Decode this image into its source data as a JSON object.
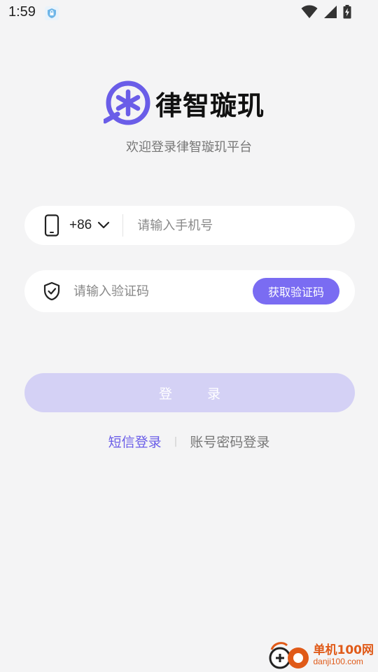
{
  "status_bar": {
    "time": "1:59",
    "icons": [
      "vpn-shield-icon",
      "wifi-icon",
      "signal-icon",
      "battery-charging-icon"
    ]
  },
  "brand": {
    "name": "律智璇玑",
    "subtitle": "欢迎登录律智璇玑平台",
    "accent_color": "#6a5de8"
  },
  "phone_field": {
    "country_code": "+86",
    "placeholder": "请输入手机号",
    "value": ""
  },
  "code_field": {
    "placeholder": "请输入验证码",
    "value": "",
    "get_code_label": "获取验证码"
  },
  "login_button": {
    "label": "登 录",
    "disabled": true
  },
  "login_modes": {
    "sms": "短信登录",
    "separator": "|",
    "password": "账号密码登录"
  },
  "watermark": {
    "line1": "单机100网",
    "line2": "danji100.com"
  }
}
